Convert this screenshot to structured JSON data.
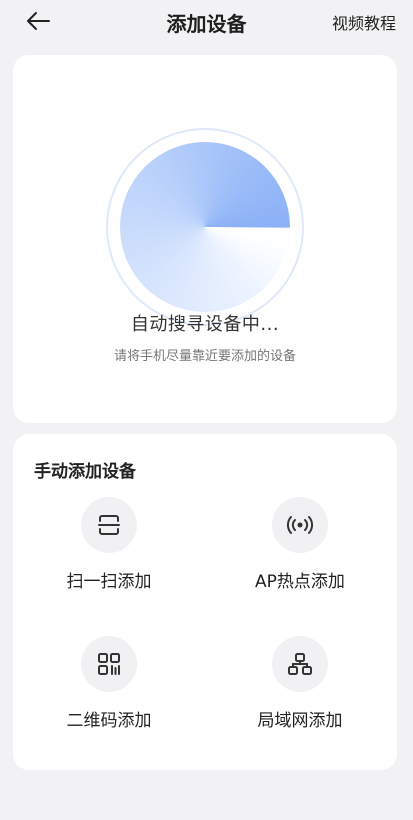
{
  "header": {
    "title": "添加设备",
    "action_label": "视频教程",
    "back_icon": "arrow-left-icon"
  },
  "scan": {
    "status": "自动搜寻设备中...",
    "hint": "请将手机尽量靠近要添加的设备",
    "accent_color": "#8cb1f6"
  },
  "manual": {
    "title": "手动添加设备",
    "methods": [
      {
        "label": "扫一扫添加",
        "icon": "scan-icon"
      },
      {
        "label": "AP热点添加",
        "icon": "hotspot-icon"
      },
      {
        "label": "二维码添加",
        "icon": "qr-code-icon"
      },
      {
        "label": "局域网添加",
        "icon": "lan-network-icon"
      }
    ]
  }
}
